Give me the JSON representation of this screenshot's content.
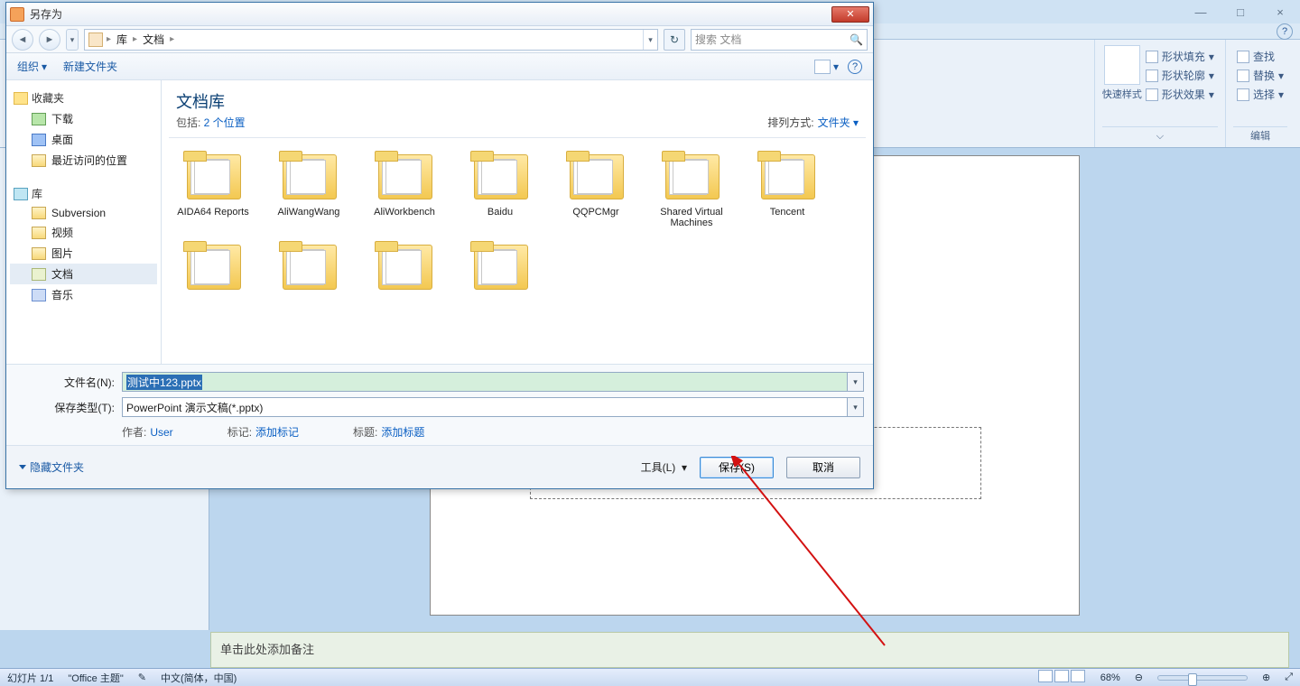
{
  "ppt": {
    "win": {
      "min": "—",
      "max": "□",
      "close": "×"
    },
    "ribbon": {
      "quickstyle": "快速样式",
      "shape_fill": "形状填充",
      "shape_outline": "形状轮廓",
      "shape_effects": "形状效果",
      "find": "查找",
      "replace": "替换",
      "select": "选择",
      "group_edit": "编辑"
    },
    "notes_placeholder": "单击此处添加备注",
    "status": {
      "slide": "幻灯片 1/1",
      "theme": "\"Office 主题\"",
      "lang": "中文(简体，中国)",
      "zoom": "68%"
    }
  },
  "dlg": {
    "title": "另存为",
    "breadcrumb": {
      "seg1": "库",
      "seg2": "文档"
    },
    "search_placeholder": "搜索 文档",
    "toolbar": {
      "org": "组织",
      "newf": "新建文件夹"
    },
    "tree": {
      "fav": "收藏夹",
      "dl": "下载",
      "desk": "桌面",
      "recent": "最近访问的位置",
      "lib": "库",
      "sub": "Subversion",
      "vid": "视频",
      "pic": "图片",
      "doc": "文档",
      "mus": "音乐"
    },
    "content": {
      "title": "文档库",
      "sub_prefix": "包括: ",
      "sub_link": "2 个位置",
      "sort_label": "排列方式:",
      "sort_value": "文件夹"
    },
    "folders": [
      "AIDA64 Reports",
      "AliWangWang",
      "AliWorkbench",
      "Baidu",
      "QQPCMgr",
      "Shared Virtual Machines",
      "Tencent"
    ],
    "fields": {
      "fname_label": "文件名(N):",
      "fname_value": "测试中123.pptx",
      "ftype_label": "保存类型(T):",
      "ftype_value": "PowerPoint 演示文稿(*.pptx)",
      "author_l": "作者:",
      "author_v": "User",
      "tag_l": "标记:",
      "tag_v": "添加标记",
      "title_l": "标题:",
      "title_v": "添加标题"
    },
    "bottom": {
      "hide": "隐藏文件夹",
      "tools": "工具(L)",
      "save": "保存(S)",
      "cancel": "取消"
    }
  }
}
